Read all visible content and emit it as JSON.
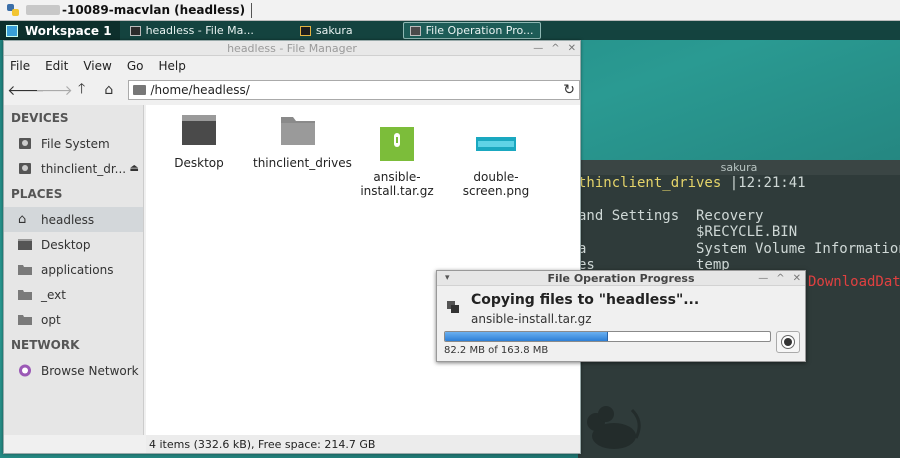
{
  "session_bar": {
    "title": "-10089-macvlan (headless)"
  },
  "taskbar": {
    "workspace": "Workspace 1",
    "tasks": [
      "headless - File Ma...",
      "sakura",
      "File Operation Pro..."
    ]
  },
  "file_manager": {
    "title": "headless - File Manager",
    "menu": [
      "File",
      "Edit",
      "View",
      "Go",
      "Help"
    ],
    "path": "/home/headless/",
    "sections": {
      "devices": "DEVICES",
      "places": "PLACES",
      "network": "NETWORK"
    },
    "devices": [
      "File System",
      "thinclient_dr..."
    ],
    "places": [
      "headless",
      "Desktop",
      "applications",
      "_ext",
      "opt"
    ],
    "network": [
      "Browse Network"
    ],
    "items": [
      {
        "name": "Desktop"
      },
      {
        "name": "thinclient_drives"
      },
      {
        "name": "ansible-\ninstall.tar.gz"
      },
      {
        "name": "double-\nscreen.png"
      }
    ],
    "status": "4 items (332.6 kB), Free space: 214.7 GB"
  },
  "terminal": {
    "title": "sakura",
    "lines": [
      {
        "text": "thinclient_drives",
        "extra": " |12:21:41"
      },
      {
        "text": "and Settings  Recovery"
      },
      {
        "text": "              $RECYCLE.BIN"
      },
      {
        "text": "a             System Volume Information"
      },
      {
        "text": "es            temp"
      },
      {
        "text": "DownloadData"
      }
    ]
  },
  "dialog": {
    "title": "File Operation Progress",
    "heading": "Copying files to \"headless\"...",
    "file": "ansible-install.tar.gz",
    "progress_text": "82.2 MB of 163.8 MB",
    "progress_fraction": 0.502
  },
  "colors": {
    "accent": "#2d7fd6",
    "desktop": "#2a9a92"
  }
}
